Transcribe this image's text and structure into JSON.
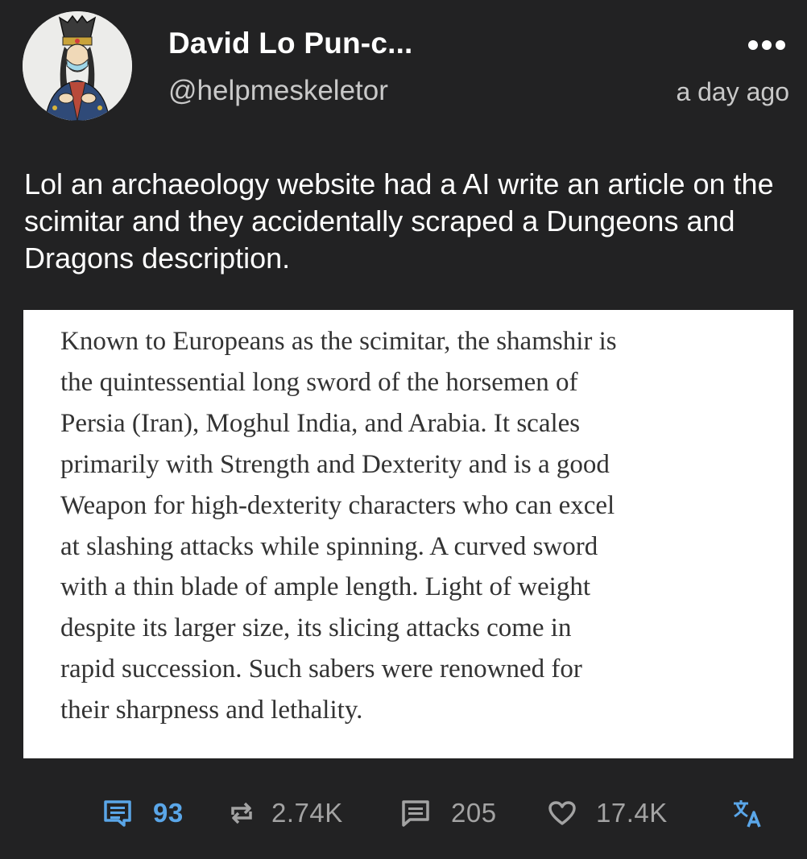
{
  "post": {
    "author": {
      "display_name": "David Lo Pun-c...",
      "handle": "@helpmeskeletor"
    },
    "timestamp": "a day ago",
    "more_icon": "more-horizontal-icon",
    "text": "Lol an archaeology website had a AI write an article on the scimitar and they accidentally scraped a Dungeons and Dragons description.",
    "quote_image_text": "Known to Europeans as the scimitar, the shamshir is\nthe quintessential long sword of the horsemen of\nPersia (Iran), Moghul India, and Arabia. It scales\nprimarily with Strength and Dexterity and is a good\nWeapon for high-dexterity characters who can excel\nat slashing attacks while spinning. A curved sword\nwith a thin blade of ample length. Light of weight\ndespite its larger size, its slicing attacks come in\nrapid succession.  Such sabers were renowned for\ntheir sharpness and lethality."
  },
  "actions": {
    "comments": {
      "icon": "comments-icon",
      "count": "93"
    },
    "reblogs": {
      "icon": "reblog-icon",
      "count": "2.74K"
    },
    "replies": {
      "icon": "reply-icon",
      "count": "205"
    },
    "likes": {
      "icon": "heart-icon",
      "count": "17.4K"
    },
    "translate": {
      "icon": "translate-icon"
    }
  },
  "colors": {
    "background": "#222223",
    "accent": "#5aa6e8",
    "muted": "#a3a3a3"
  }
}
